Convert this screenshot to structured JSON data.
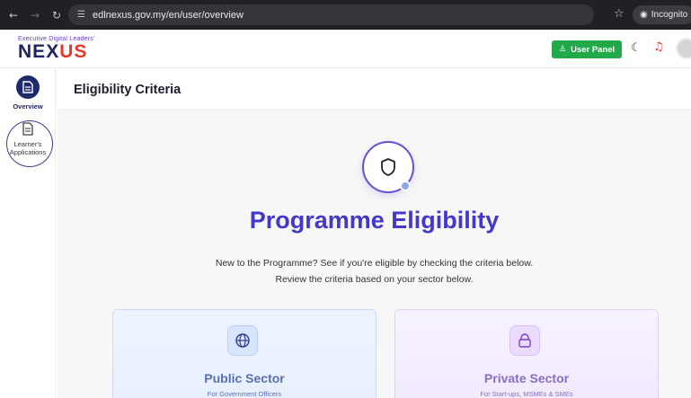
{
  "browser": {
    "url": "edlnexus.gov.my/en/user/overview",
    "incognito_label": "Incognito"
  },
  "header": {
    "logo_tagline": "Executive Digital Leaders'",
    "logo_text": {
      "part1": "NE",
      "part2": "X",
      "part3": "US"
    },
    "user_panel_label": "User Panel",
    "icons": [
      "user-icon",
      "moon-icon",
      "headset-icon"
    ]
  },
  "sidebar": {
    "items": [
      {
        "label": "Overview",
        "icon": "document-icon",
        "active": true
      },
      {
        "label": "Learner's Applications",
        "icon": "document-icon",
        "active": false
      }
    ]
  },
  "main": {
    "page_title": "Eligibility Criteria",
    "hero_title": "Programme Eligibility",
    "hero_sub_line1": "New to the Programme? See if you're eligible by checking the criteria below.",
    "hero_sub_line2": "Review the criteria based on your sector below.",
    "cards": [
      {
        "title": "Public Sector",
        "subtitle": "For Government Officers",
        "icon": "globe-icon"
      },
      {
        "title": "Private Sector",
        "subtitle": "For Start-ups, MSMEs & SMEs",
        "icon": "lock-icon"
      }
    ]
  },
  "colors": {
    "accent": "#4338ca",
    "user_panel": "#22a94a",
    "brand_red": "#e23a2b",
    "brand_navy": "#20255e"
  }
}
